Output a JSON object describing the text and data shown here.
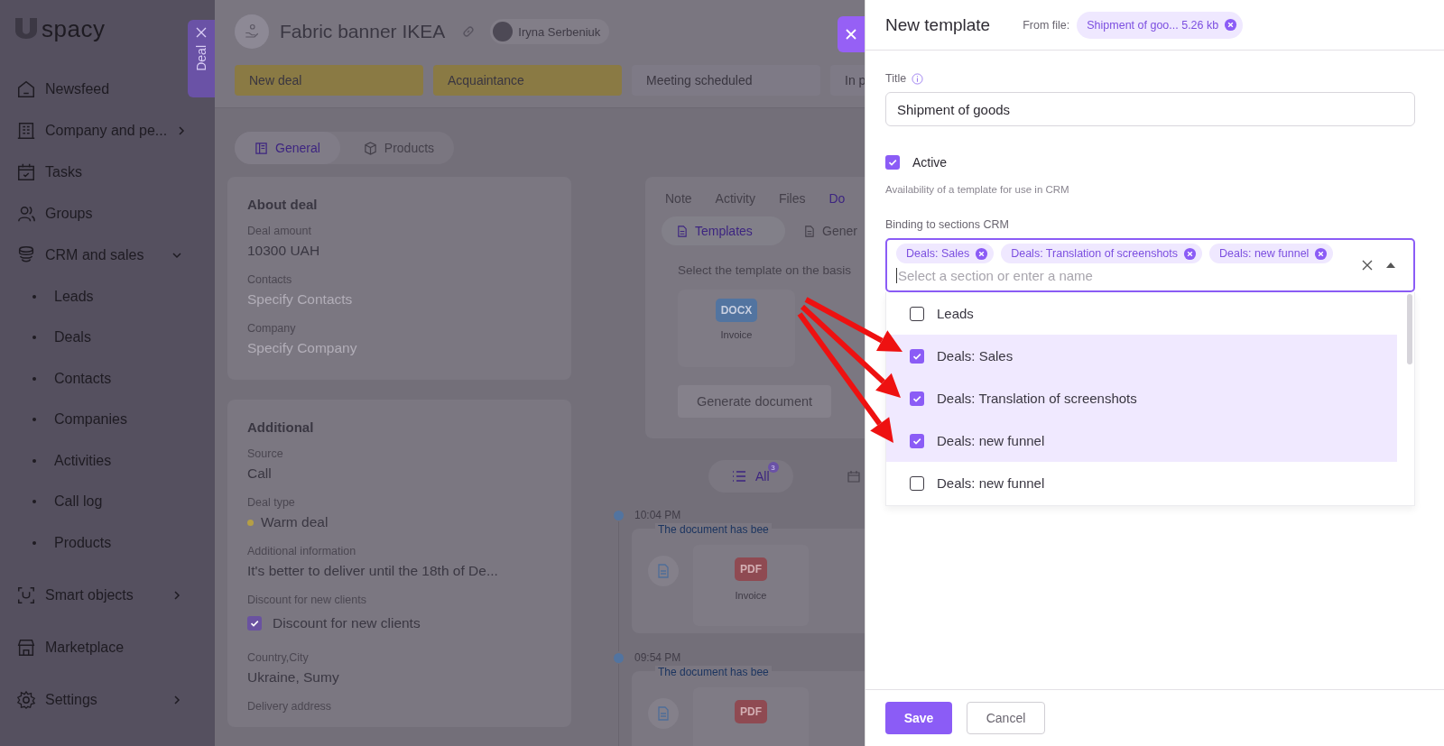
{
  "sidebar": {
    "logo": "spacy",
    "items": [
      {
        "label": "Newsfeed",
        "kind": "link"
      },
      {
        "label": "Company and pe...",
        "kind": "group",
        "expanded": false
      },
      {
        "label": "Tasks",
        "kind": "link"
      },
      {
        "label": "Groups",
        "kind": "link"
      },
      {
        "label": "CRM and sales",
        "kind": "group",
        "expanded": true,
        "children": [
          {
            "label": "Leads"
          },
          {
            "label": "Deals"
          },
          {
            "label": "Contacts"
          },
          {
            "label": "Companies"
          },
          {
            "label": "Activities"
          },
          {
            "label": "Call log"
          },
          {
            "label": "Products"
          }
        ]
      },
      {
        "label": "Smart objects",
        "kind": "group",
        "expanded": false
      },
      {
        "label": "Marketplace",
        "kind": "link"
      },
      {
        "label": "Settings",
        "kind": "group",
        "expanded": false
      }
    ]
  },
  "deal_tab": {
    "label": "Deal"
  },
  "deal": {
    "title": "Fabric banner IKEA",
    "owner": "Iryna Serbeniuk",
    "stages": [
      {
        "label": "New deal",
        "color": "#8a7a44"
      },
      {
        "label": "Acquaintance",
        "color": "#8a7a44"
      },
      {
        "label": "Meeting scheduled",
        "color": "#7e7a86"
      },
      {
        "label": "In p",
        "color": "#7e7a86"
      }
    ],
    "tabs": [
      {
        "label": "General",
        "selected": true
      },
      {
        "label": "Products",
        "selected": false
      }
    ],
    "cards": [
      {
        "title": "About deal",
        "fields": [
          {
            "label": "Deal amount",
            "value": "10300 UAH",
            "kind": "text"
          },
          {
            "label": "Contacts",
            "placeholder": "Specify Contacts",
            "kind": "empty"
          },
          {
            "label": "Company",
            "placeholder": "Specify Company",
            "kind": "empty"
          }
        ]
      },
      {
        "title": "Additional",
        "fields": [
          {
            "label": "Source",
            "value": "Call",
            "kind": "text"
          },
          {
            "label": "Deal type",
            "value": "Warm deal",
            "kind": "tag",
            "color": "#b59f45"
          },
          {
            "label": "Additional information",
            "value": "It's better to deliver until the 18th of De...",
            "kind": "text"
          },
          {
            "label": "Discount for new clients",
            "value": "Discount for new clients",
            "kind": "checkbox",
            "checked": true
          },
          {
            "label": "Country,City",
            "value": "Ukraine, Sumy",
            "kind": "text"
          },
          {
            "label": "Delivery address",
            "kind": "label"
          }
        ]
      }
    ],
    "activity": {
      "tabs": [
        {
          "label": "Note",
          "selected": false
        },
        {
          "label": "Activity",
          "selected": false
        },
        {
          "label": "Files",
          "selected": false
        },
        {
          "label": "Do",
          "selected": true
        }
      ],
      "subtabs": [
        {
          "label": "Templates",
          "selected": true
        },
        {
          "label": "Gener",
          "selected": false
        }
      ],
      "hint": "Select the template on the basis",
      "template": {
        "badge": "DOCX",
        "name": "Invoice"
      },
      "generate_button": "Generate document",
      "filter": {
        "label": "All",
        "count": "3"
      },
      "timeline": [
        {
          "time": "10:04 PM",
          "note": "The document has bee",
          "badge": "PDF",
          "name": "Invoice"
        },
        {
          "time": "09:54 PM",
          "note": "The document has bee",
          "badge": "PDF"
        }
      ]
    }
  },
  "panel": {
    "title": "New template",
    "from_file_label": "From file:",
    "file_chip": "Shipment of goo... 5.26 kb",
    "title_label": "Title",
    "title_value": "Shipment of goods",
    "active": {
      "label": "Active",
      "checked": true
    },
    "active_hint": "Availability of a template for use in CRM",
    "binding_label": "Binding to sections CRM",
    "chips": [
      "Deals: Sales",
      "Deals: Translation of screenshots",
      "Deals: new funnel"
    ],
    "placeholder": "Select a section or enter a name",
    "options": [
      {
        "label": "Leads",
        "checked": false
      },
      {
        "label": "Deals: Sales",
        "checked": true
      },
      {
        "label": "Deals: Translation of screenshots",
        "checked": true
      },
      {
        "label": "Deals: new funnel",
        "checked": true
      },
      {
        "label": "Deals: new funnel",
        "checked": false
      }
    ],
    "buttons": [
      {
        "label": "Save",
        "kind": "primary"
      },
      {
        "label": "Cancel",
        "kind": "secondary"
      }
    ]
  }
}
